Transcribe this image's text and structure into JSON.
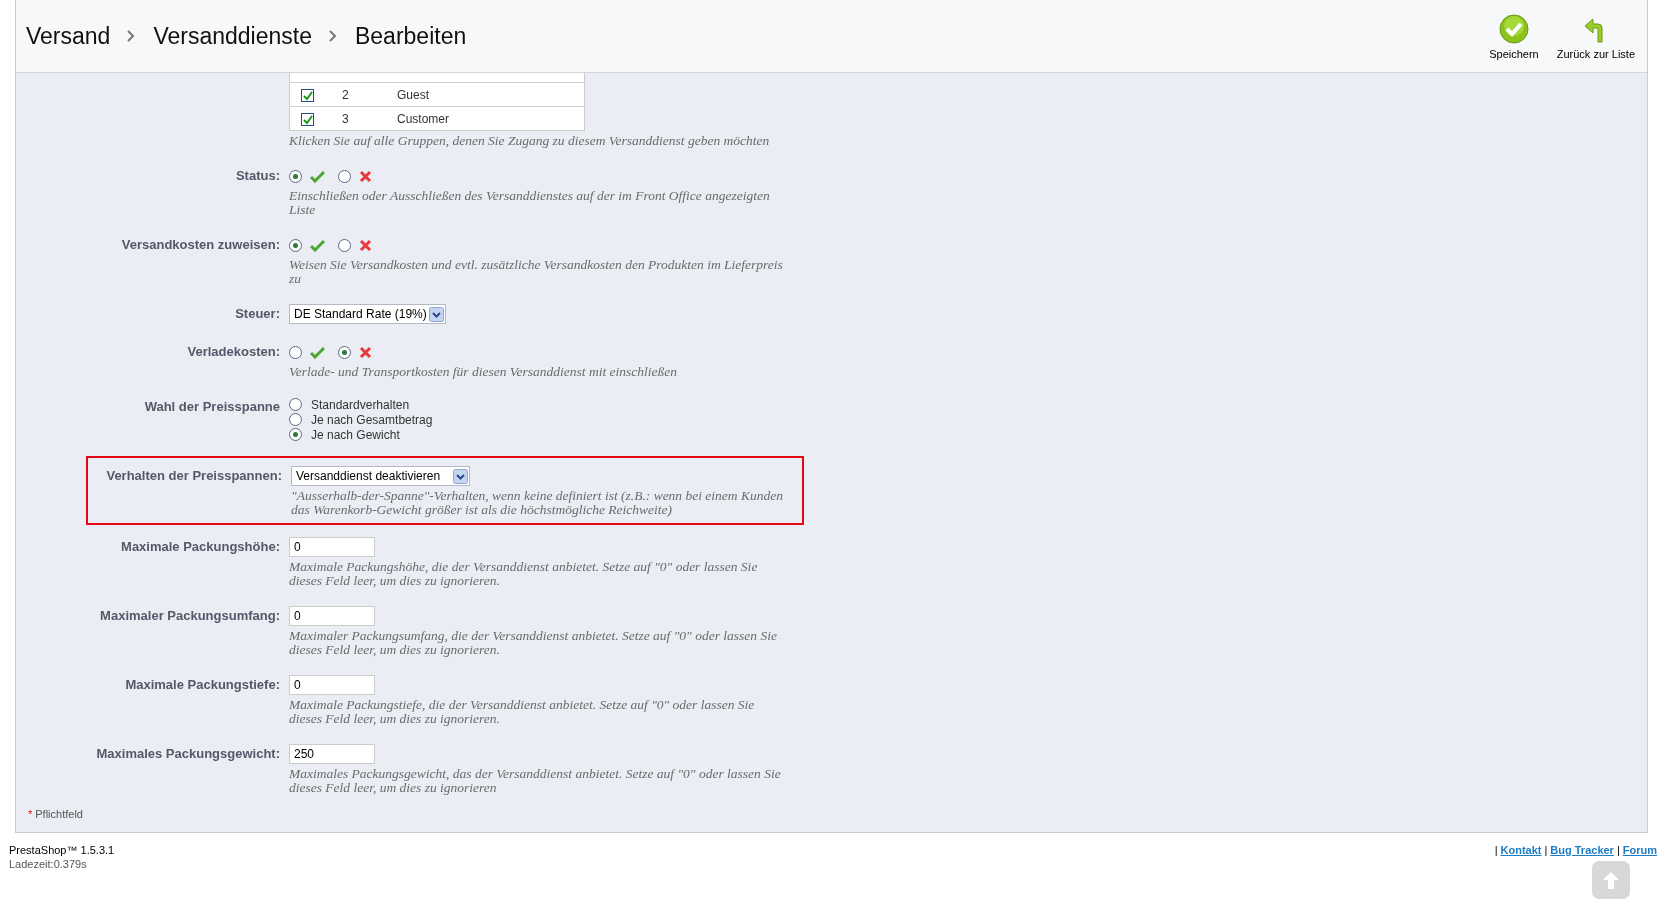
{
  "header": {
    "breadcrumb": [
      "Versand",
      "Versanddienste",
      "Bearbeiten"
    ],
    "actions": [
      {
        "kind": "save",
        "label": "Speichern"
      },
      {
        "kind": "back",
        "label": "Zurück zur Liste"
      }
    ]
  },
  "form": {
    "fields": [
      {
        "kind": "groups",
        "hint": "Klicken Sie auf alle Gruppen, denen Sie Zugang zu diesem Versanddienst geben möchten",
        "rows": [
          {
            "id": "2",
            "name": "Guest",
            "checked": true
          },
          {
            "id": "3",
            "name": "Customer",
            "checked": true
          }
        ]
      },
      {
        "kind": "toggle",
        "label": "Status:",
        "options": [
          {
            "kind": "yes",
            "selected": true
          },
          {
            "kind": "no",
            "selected": false
          }
        ],
        "hint": "Einschließen oder Ausschließen des Versanddienstes auf der im Front Office angezeigten Liste"
      },
      {
        "kind": "toggle",
        "label": "Versandkosten zuweisen:",
        "options": [
          {
            "kind": "yes",
            "selected": true
          },
          {
            "kind": "no",
            "selected": false
          }
        ],
        "hint": "Weisen Sie Versandkosten und evtl. zusätzliche Versandkosten den Produkten im Lieferpreis zu"
      },
      {
        "kind": "select",
        "label": "Steuer:",
        "value": "DE Standard Rate (19%)",
        "highlighted": false
      },
      {
        "kind": "toggle",
        "label": "Verladekosten:",
        "options": [
          {
            "kind": "yes",
            "selected": false
          },
          {
            "kind": "no",
            "selected": true
          }
        ],
        "hint": "Verlade- und Transportkosten für diesen Versanddienst mit einschließen"
      },
      {
        "kind": "radios",
        "label": "Wahl der Preisspanne",
        "options": [
          {
            "label": "Standardverhalten",
            "selected": false
          },
          {
            "label": "Je nach Gesamtbetrag",
            "selected": false
          },
          {
            "label": "Je nach Gewicht",
            "selected": true
          }
        ]
      },
      {
        "kind": "select",
        "label": "Verhalten der Preisspannen:",
        "value": "Versanddienst deaktivieren",
        "highlighted": true,
        "hint": "\"Ausserhalb-der-Spanne\"-Verhalten, wenn keine definiert ist (z.B.: wenn bei einem Kunden das Warenkorb-Gewicht größer ist als die höchstmögliche Reichweite)"
      },
      {
        "kind": "text",
        "label": "Maximale Packungshöhe:",
        "value": "0",
        "hint": "Maximale Packungshöhe, die der Versanddienst anbietet. Setze auf \"0\" oder lassen Sie dieses Feld leer, um dies zu ignorieren."
      },
      {
        "kind": "text",
        "label": "Maximaler Packungsumfang:",
        "value": "0",
        "hint": "Maximaler Packungsumfang, die der Versanddienst anbietet. Setze auf \"0\" oder lassen Sie dieses Feld leer, um dies zu ignorieren."
      },
      {
        "kind": "text",
        "label": "Maximale Packungstiefe:",
        "value": "0",
        "hint": "Maximale Packungstiefe, die der Versanddienst anbietet. Setze auf \"0\" oder lassen Sie dieses Feld leer, um dies zu ignorieren."
      },
      {
        "kind": "text",
        "label": "Maximales Packungsgewicht:",
        "value": "250",
        "hint": "Maximales Packungsgewicht, das der Versanddienst anbietet. Setze auf \"0\" oder lassen Sie dieses Feld leer, um dies zu ignorieren"
      }
    ]
  },
  "required_note": {
    "mark": "*",
    "text": "Pflichtfeld"
  },
  "footer": {
    "version": "PrestaShop™ 1.5.3.1",
    "load_time": "Ladezeit:0.379s",
    "separator": "|",
    "links": [
      "Kontakt",
      "Bug Tracker",
      "Forum"
    ]
  }
}
